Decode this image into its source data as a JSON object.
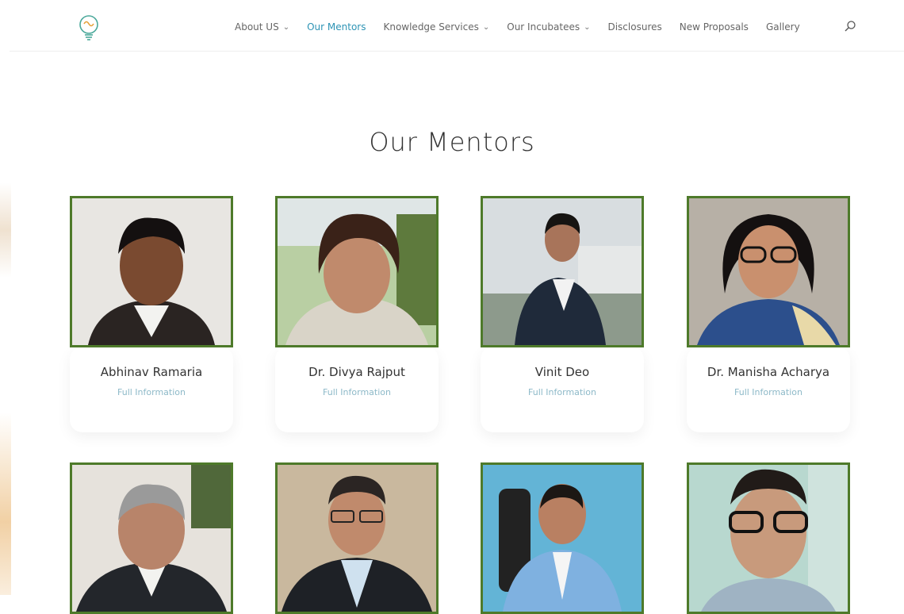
{
  "nav": {
    "items": [
      {
        "label": "About US",
        "dropdown": true,
        "active": false
      },
      {
        "label": "Our Mentors",
        "dropdown": false,
        "active": true
      },
      {
        "label": "Knowledge Services",
        "dropdown": true,
        "active": false
      },
      {
        "label": "Our Incubatees",
        "dropdown": true,
        "active": false
      },
      {
        "label": "Disclosures",
        "dropdown": false,
        "active": false
      },
      {
        "label": "New Proposals",
        "dropdown": false,
        "active": false
      },
      {
        "label": "Gallery",
        "dropdown": false,
        "active": false
      }
    ],
    "search_icon": "search-icon",
    "logo_icon": "lightbulb-logo-icon"
  },
  "main": {
    "title": "Our Mentors",
    "mentors": [
      {
        "name": "Abhinav Ramaria",
        "link": "Full Information"
      },
      {
        "name": "Dr. Divya Rajput",
        "link": "Full Information"
      },
      {
        "name": "Vinit Deo",
        "link": "Full Information"
      },
      {
        "name": "Dr. Manisha Acharya",
        "link": "Full Information"
      },
      {
        "name": "",
        "link": ""
      },
      {
        "name": "",
        "link": ""
      },
      {
        "name": "",
        "link": ""
      },
      {
        "name": "",
        "link": ""
      }
    ]
  },
  "colors": {
    "accent": "#2e94b5",
    "photo_border": "#4e7a2a",
    "link": "#8db9c8",
    "text": "#333333"
  }
}
